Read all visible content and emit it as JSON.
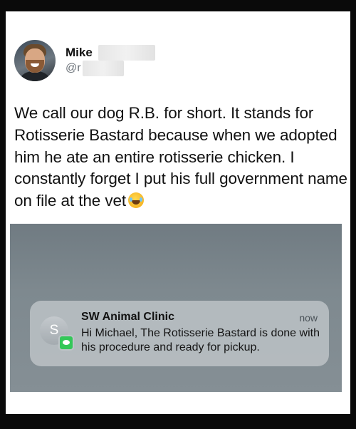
{
  "user": {
    "display_name": "Mike",
    "handle": "@r"
  },
  "tweet": {
    "text": "We call our dog R.B. for short. It stands for Rotisserie Bastard because when we adopted him he ate an entire rotisserie chicken. I constantly forget I put his full government name on file at the vet",
    "emoji_icon": "face-with-tears-of-joy-emoji"
  },
  "notification": {
    "app_icon_letter": "S",
    "badge_icon": "messages-icon",
    "title": "SW Animal Clinic",
    "time": "now",
    "body": "Hi Michael, The Rotisserie Bastard is done with his procedure and ready for pickup."
  },
  "colors": {
    "page_background": "#0a0a0a",
    "card_background": "#ffffff",
    "photo_background": "#7e898f",
    "messages_green": "#34c759"
  }
}
